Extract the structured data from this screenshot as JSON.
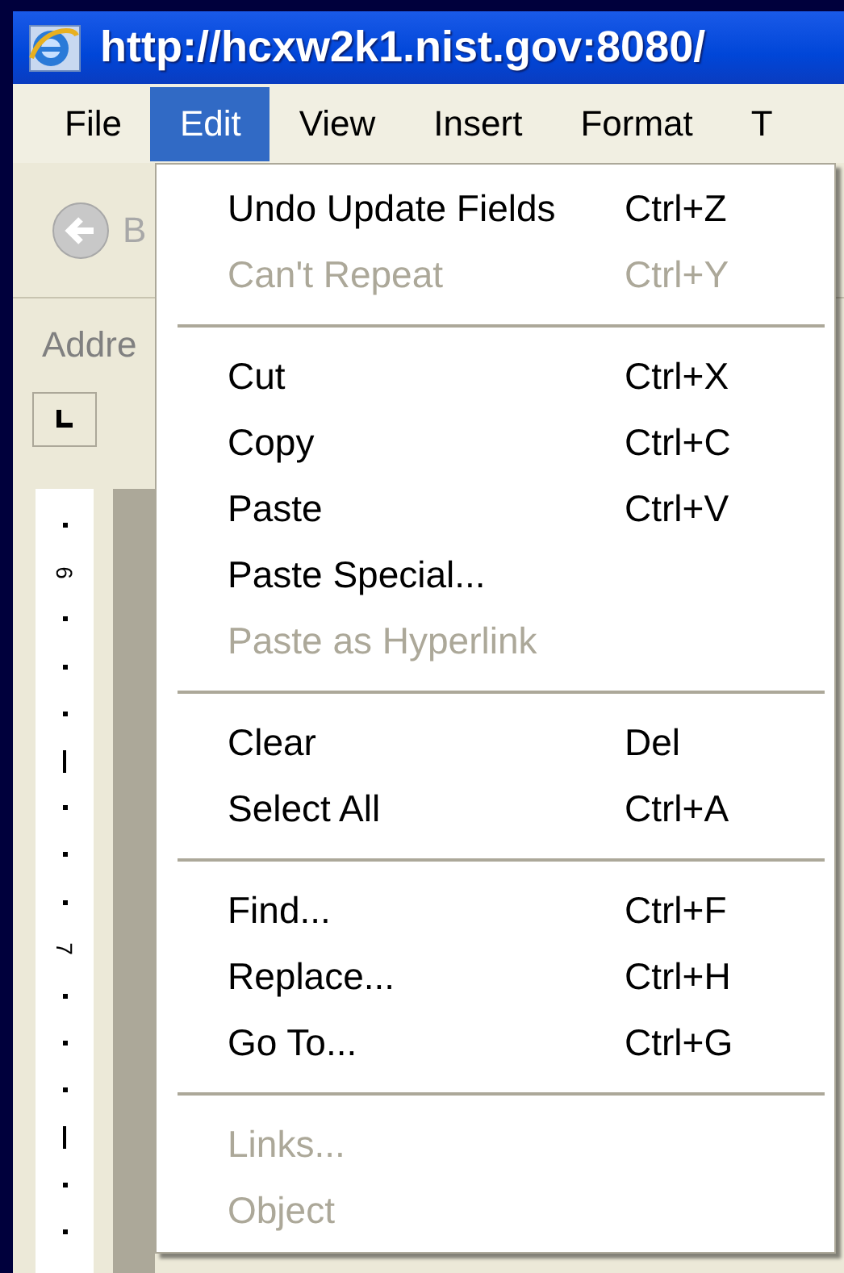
{
  "window": {
    "title": "http://hcxw2k1.nist.gov:8080/"
  },
  "menu_bar": [
    {
      "label": "File",
      "selected": false
    },
    {
      "label": "Edit",
      "selected": true
    },
    {
      "label": "View",
      "selected": false
    },
    {
      "label": "Insert",
      "selected": false
    },
    {
      "label": "Format",
      "selected": false
    },
    {
      "label": "T",
      "selected": false
    }
  ],
  "toolbar": {
    "back_label": "B"
  },
  "address_bar": {
    "label": "Addre"
  },
  "ruler": {
    "labels": [
      "6",
      "7"
    ]
  },
  "edit_menu": [
    {
      "kind": "item",
      "label": "Undo Update Fields",
      "shortcut": "Ctrl+Z",
      "disabled": false
    },
    {
      "kind": "item",
      "label": "Can't Repeat",
      "shortcut": "Ctrl+Y",
      "disabled": true
    },
    {
      "kind": "separator"
    },
    {
      "kind": "item",
      "label": "Cut",
      "shortcut": "Ctrl+X",
      "disabled": false
    },
    {
      "kind": "item",
      "label": "Copy",
      "shortcut": "Ctrl+C",
      "disabled": false
    },
    {
      "kind": "item",
      "label": "Paste",
      "shortcut": "Ctrl+V",
      "disabled": false
    },
    {
      "kind": "item",
      "label": "Paste Special...",
      "disabled": false
    },
    {
      "kind": "item",
      "label": "Paste as Hyperlink",
      "disabled": true
    },
    {
      "kind": "separator"
    },
    {
      "kind": "item",
      "label": "Clear",
      "shortcut": "Del",
      "disabled": false
    },
    {
      "kind": "item",
      "label": "Select All",
      "shortcut": "Ctrl+A",
      "disabled": false
    },
    {
      "kind": "separator"
    },
    {
      "kind": "item",
      "label": "Find...",
      "shortcut": "Ctrl+F",
      "disabled": false
    },
    {
      "kind": "item",
      "label": "Replace...",
      "shortcut": "Ctrl+H",
      "disabled": false
    },
    {
      "kind": "item",
      "label": "Go To...",
      "shortcut": "Ctrl+G",
      "disabled": false
    },
    {
      "kind": "separator"
    },
    {
      "kind": "item",
      "label": "Links...",
      "disabled": true
    },
    {
      "kind": "item",
      "label": "Object",
      "disabled": true
    }
  ]
}
